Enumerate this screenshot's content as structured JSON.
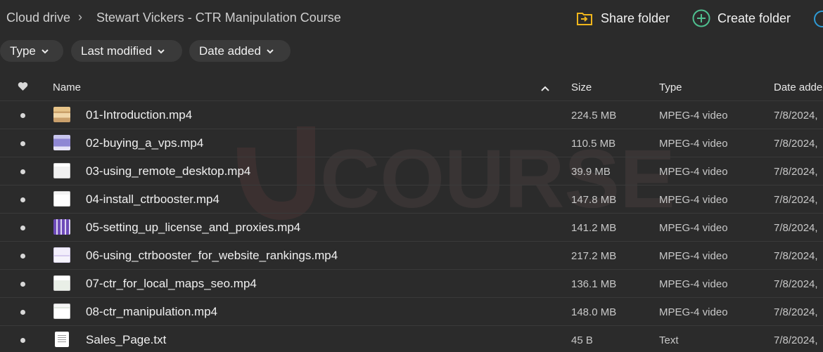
{
  "breadcrumb": {
    "root": "Cloud drive",
    "separator": "›",
    "current": "Stewart Vickers - CTR Manipulation Course"
  },
  "actions": {
    "share_label": "Share folder",
    "create_label": "Create folder"
  },
  "filters": [
    {
      "label": "Type"
    },
    {
      "label": "Last modified"
    },
    {
      "label": "Date added"
    }
  ],
  "table": {
    "headers": {
      "name": "Name",
      "size": "Size",
      "type": "Type",
      "date": "Date added"
    },
    "rows": [
      {
        "name": "01-Introduction.mp4",
        "size": "224.5 MB",
        "type": "MPEG-4 video",
        "date": "7/8/2024,"
      },
      {
        "name": "02-buying_a_vps.mp4",
        "size": "110.5 MB",
        "type": "MPEG-4 video",
        "date": "7/8/2024,"
      },
      {
        "name": "03-using_remote_desktop.mp4",
        "size": "39.9 MB",
        "type": "MPEG-4 video",
        "date": "7/8/2024,"
      },
      {
        "name": "04-install_ctrbooster.mp4",
        "size": "147.8 MB",
        "type": "MPEG-4 video",
        "date": "7/8/2024,"
      },
      {
        "name": "05-setting_up_license_and_proxies.mp4",
        "size": "141.2 MB",
        "type": "MPEG-4 video",
        "date": "7/8/2024,"
      },
      {
        "name": "06-using_ctrbooster_for_website_rankings.mp4",
        "size": "217.2 MB",
        "type": "MPEG-4 video",
        "date": "7/8/2024,"
      },
      {
        "name": "07-ctr_for_local_maps_seo.mp4",
        "size": "136.1 MB",
        "type": "MPEG-4 video",
        "date": "7/8/2024,"
      },
      {
        "name": "08-ctr_manipulation.mp4",
        "size": "148.0 MB",
        "type": "MPEG-4 video",
        "date": "7/8/2024,"
      },
      {
        "name": "Sales_Page.txt",
        "size": "45 B",
        "type": "Text",
        "date": "7/8/2024,"
      }
    ]
  },
  "watermark": {
    "text": "COURSE"
  },
  "colors": {
    "background": "#2b2b2b",
    "share_icon": "#f0b61c",
    "create_icon": "#4fbf8f",
    "edge_button": "#2e9bd6"
  },
  "icons": [
    "chevron-right-icon",
    "share-folder-icon",
    "create-folder-icon",
    "chevron-down-icon",
    "heart-icon",
    "sort-up-icon"
  ]
}
